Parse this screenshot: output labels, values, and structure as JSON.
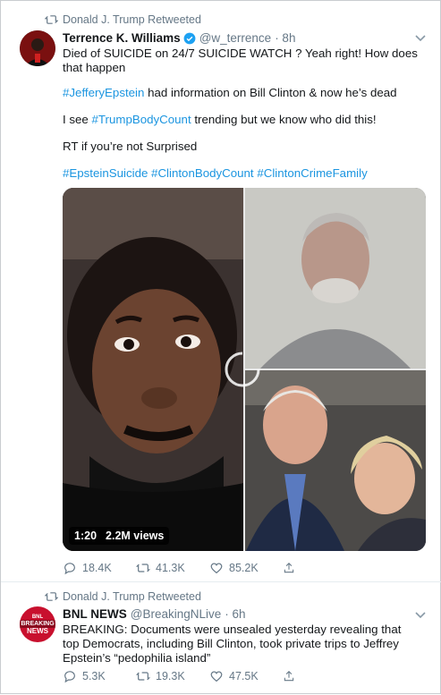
{
  "tweets": [
    {
      "retweeted_by": "Donald J. Trump Retweeted",
      "name": "Terrence K. Williams",
      "handle": "@w_terrence",
      "time": "· 8h",
      "lines": {
        "l1": "Died of SUICIDE on 24/7 SUICIDE WATCH ? Yeah right! How does that happen",
        "l2_tag": "#JefferyEpstein",
        "l2_rest": " had information on Bill Clinton & now he’s dead",
        "l3_pre": "I see ",
        "l3_tag": "#TrumpBodyCount",
        "l3_rest": " trending but we know who did this!",
        "l4": "RT if you’re not Surprised",
        "l5_tags": "#EpsteinSuicide #ClintonBodyCount #ClintonCrimeFamily"
      },
      "video": {
        "duration": "1:20",
        "views": "2.2M views"
      },
      "stats": {
        "replies": "18.4K",
        "retweets": "41.3K",
        "likes": "85.2K"
      }
    },
    {
      "retweeted_by": "Donald J. Trump Retweeted",
      "name": "BNL NEWS",
      "handle": "@BreakingNLive",
      "time": "· 6h",
      "avatar_text": {
        "top": "BNL",
        "middle": "BREAKING",
        "bottom": "NEWS"
      },
      "text": "BREAKING: Documents were unsealed yesterday revealing that top Democrats, including Bill Clinton, took private trips to Jeffrey Epstein’s “pedophilia island”",
      "stats": {
        "replies": "5.3K",
        "retweets": "19.3K",
        "likes": "47.5K"
      }
    }
  ],
  "colors": {
    "link": "#1b95e0",
    "muted": "#657786",
    "verified": "#1da1f2",
    "bnl_red": "#c8102e"
  },
  "icons": [
    "retweet-icon",
    "verified-badge-icon",
    "chevron-down-icon",
    "reply-icon",
    "like-icon",
    "share-icon",
    "loading-spinner-icon"
  ]
}
